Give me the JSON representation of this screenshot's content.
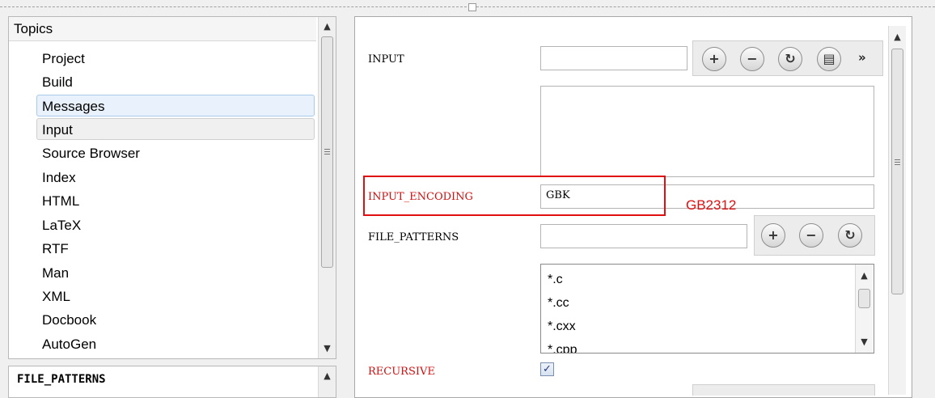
{
  "topics": {
    "header": "Topics",
    "items": [
      "Project",
      "Build",
      "Messages",
      "Input",
      "Source Browser",
      "Index",
      "HTML",
      "LaTeX",
      "RTF",
      "Man",
      "XML",
      "Docbook",
      "AutoGen"
    ]
  },
  "help": {
    "title": "FILE_PATTERNS"
  },
  "settings": {
    "input_label": "INPUT",
    "input_value": "",
    "more": "»",
    "input_encoding_label": "INPUT_ENCODING",
    "input_encoding_value": "GBK",
    "annotation": "GB2312",
    "file_patterns_label": "FILE_PATTERNS",
    "file_patterns_value": "",
    "patterns": [
      "*.c",
      "*.cc",
      "*.cxx",
      "*.cpp"
    ],
    "recursive_label": "RECURSIVE",
    "recursive_checked": true
  },
  "icons": {
    "add": "+",
    "remove": "−",
    "refresh": "↻",
    "file": "▤",
    "up": "▲",
    "down": "▼",
    "grip": "≡",
    "check": "✓"
  },
  "colors": {
    "accent_red": "#e01010",
    "selection": "#e9f2fc"
  }
}
